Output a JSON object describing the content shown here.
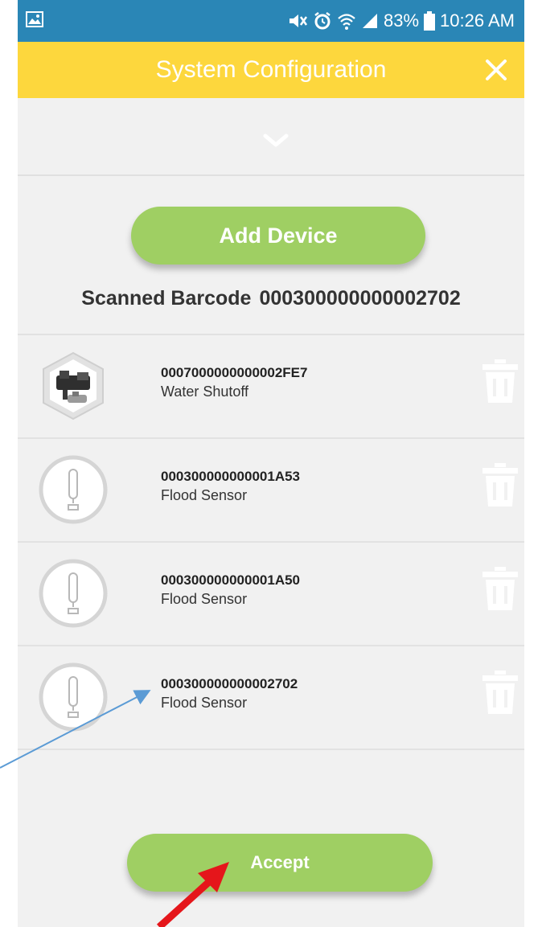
{
  "status_bar": {
    "battery": "83%",
    "time": "10:26 AM",
    "icons": [
      "image-icon",
      "mute-icon",
      "alarm-icon",
      "wifi-icon",
      "signal-icon",
      "battery-icon"
    ]
  },
  "header": {
    "title": "System Configuration",
    "close_icon": "close-icon",
    "background": "#fdd73d"
  },
  "collapse": {
    "icon": "chevron-down-icon"
  },
  "add_device": {
    "label": "Add Device"
  },
  "scanned": {
    "label": "Scanned Barcode",
    "value": "000300000000002702"
  },
  "devices": [
    {
      "code": "0007000000000002FE7",
      "type": "Water Shutoff",
      "icon": "water-shutoff-icon"
    },
    {
      "code": "000300000000001A53",
      "type": "Flood Sensor",
      "icon": "flood-sensor-icon"
    },
    {
      "code": "000300000000001A50",
      "type": "Flood Sensor",
      "icon": "flood-sensor-icon"
    },
    {
      "code": "000300000000002702",
      "type": "Flood Sensor",
      "icon": "flood-sensor-icon"
    }
  ],
  "accept": {
    "label": "Accept"
  },
  "colors": {
    "status_bar": "#2a86b6",
    "accent_green": "#9fcf63",
    "annotation_blue": "#5b9bd5",
    "annotation_red": "#e5161b"
  }
}
